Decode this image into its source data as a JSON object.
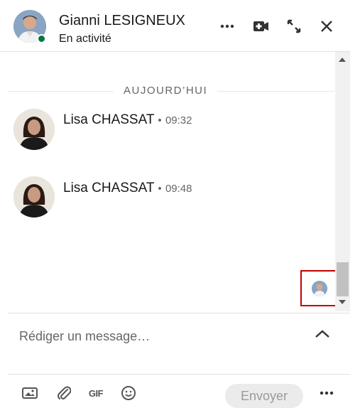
{
  "header": {
    "name": "Gianni LESIGNEUX",
    "status": "En activité",
    "more_icon": "ellipsis-icon",
    "video_icon": "video-call-icon",
    "expand_icon": "expand-arrows-icon",
    "close_icon": "close-icon"
  },
  "conversation": {
    "date_divider": "AUJOURD’HUI",
    "messages": [
      {
        "sender": "Lisa CHASSAT",
        "separator": "•",
        "time": "09:32"
      },
      {
        "sender": "Lisa CHASSAT",
        "separator": "•",
        "time": "09:48"
      }
    ]
  },
  "composer": {
    "placeholder": "Rédiger un message…",
    "send_label": "Envoyer"
  },
  "toolbar": {
    "image_icon": "image-icon",
    "attach_icon": "paperclip-icon",
    "gif_label": "GIF",
    "emoji_icon": "emoji-icon",
    "more_icon": "ellipsis-icon"
  },
  "colors": {
    "presence": "#057642",
    "highlight_border": "#c00000",
    "text": "#191919",
    "muted": "#666666"
  }
}
